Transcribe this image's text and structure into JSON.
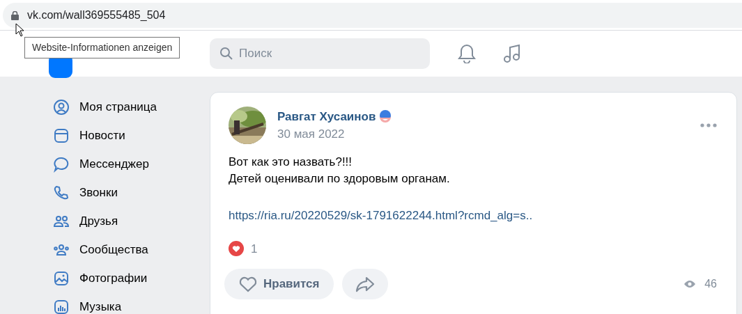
{
  "browser": {
    "url": "vk.com/wall369555485_504",
    "tooltip": "Website-Informationen anzeigen"
  },
  "header": {
    "search": {
      "placeholder": "Поиск"
    }
  },
  "sidebar": {
    "items": [
      {
        "label": "Моя страница"
      },
      {
        "label": "Новости"
      },
      {
        "label": "Мессенджер"
      },
      {
        "label": "Звонки"
      },
      {
        "label": "Друзья"
      },
      {
        "label": "Сообщества"
      },
      {
        "label": "Фотографии"
      },
      {
        "label": "Музыка"
      }
    ]
  },
  "post": {
    "author": "Равгат Хусаинов",
    "date": "30 мая 2022",
    "lines": [
      "Вот как это назвать?!!!",
      "Детей оценивали по здоровым органам."
    ],
    "link": "https://ria.ru/20220529/sk-1791622244.html?rcmd_alg=s..",
    "reactions": "1",
    "like_button": "Нравится",
    "views": "46"
  }
}
